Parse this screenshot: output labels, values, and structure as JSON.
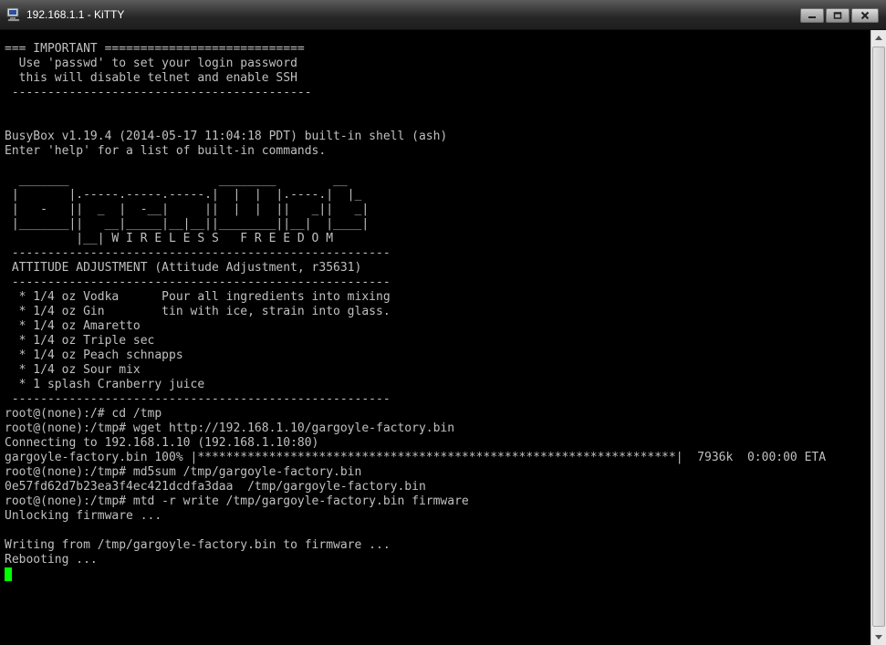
{
  "window": {
    "title": "192.168.1.1 - KiTTY",
    "icons": {
      "app": "terminal-app-icon",
      "minimize": "minimize-icon",
      "maximize": "maximize-icon",
      "close": "close-icon"
    }
  },
  "terminal": {
    "fg_color": "#c0c0c0",
    "bg_color": "#000000",
    "cursor_color": "#00ff00",
    "lines": [
      "=== IMPORTANT ============================",
      "  Use 'passwd' to set your login password",
      "  this will disable telnet and enable SSH",
      " ------------------------------------------",
      "",
      "",
      "BusyBox v1.19.4 (2014-05-17 11:04:18 PDT) built-in shell (ash)",
      "Enter 'help' for a list of built-in commands.",
      "",
      "  _______                     ________        __",
      " |       |.-----.-----.-----.|  |  |  |.----.|  |_",
      " |   -   ||  _  |  -__|     ||  |  |  ||   _||   _|",
      " |_______||   __|_____|__|__||________||__|  |____|",
      "          |__| W I R E L E S S   F R E E D O M",
      " -----------------------------------------------------",
      " ATTITUDE ADJUSTMENT (Attitude Adjustment, r35631)",
      " -----------------------------------------------------",
      "  * 1/4 oz Vodka      Pour all ingredients into mixing",
      "  * 1/4 oz Gin        tin with ice, strain into glass.",
      "  * 1/4 oz Amaretto",
      "  * 1/4 oz Triple sec",
      "  * 1/4 oz Peach schnapps",
      "  * 1/4 oz Sour mix",
      "  * 1 splash Cranberry juice",
      " -----------------------------------------------------",
      "root@(none):/# cd /tmp",
      "root@(none):/tmp# wget http://192.168.1.10/gargoyle-factory.bin",
      "Connecting to 192.168.1.10 (192.168.1.10:80)",
      "gargoyle-factory.bin 100% |*******************************************************************|  7936k  0:00:00 ETA",
      "root@(none):/tmp# md5sum /tmp/gargoyle-factory.bin",
      "0e57fd62d7b23ea3f4ec421dcdfa3daa  /tmp/gargoyle-factory.bin",
      "root@(none):/tmp# mtd -r write /tmp/gargoyle-factory.bin firmware",
      "Unlocking firmware ...",
      "",
      "Writing from /tmp/gargoyle-factory.bin to firmware ...",
      "Rebooting ..."
    ]
  }
}
